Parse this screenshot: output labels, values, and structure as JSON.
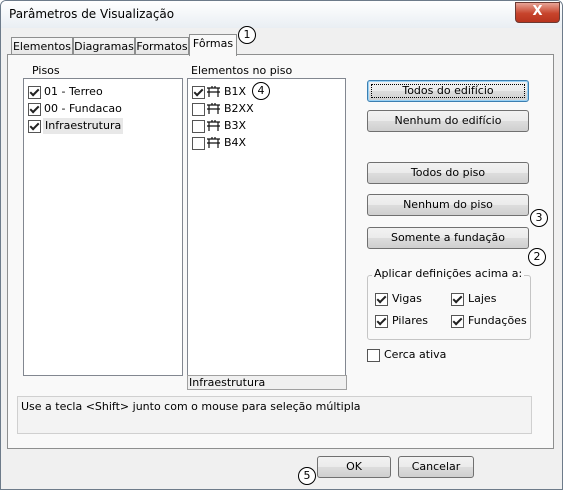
{
  "window": {
    "title": "Parâmetros de Visualização",
    "close_symbol": "X"
  },
  "tabs": [
    {
      "label": "Elementos",
      "active": false
    },
    {
      "label": "Diagramas",
      "active": false
    },
    {
      "label": "Formatos",
      "active": false
    },
    {
      "label": "Fôrmas",
      "active": true
    }
  ],
  "pisos": {
    "label": "Pisos",
    "items": [
      {
        "label": "01 - Terreo",
        "checked": true
      },
      {
        "label": "00 - Fundacao",
        "checked": true
      },
      {
        "label": "Infraestrutura",
        "checked": true,
        "selected": true
      }
    ]
  },
  "elementos": {
    "label": "Elementos no piso",
    "items": [
      {
        "label": "B1X",
        "checked": true,
        "icon": "beam-icon"
      },
      {
        "label": "B2XX",
        "checked": false,
        "icon": "beam-icon"
      },
      {
        "label": "B3X",
        "checked": false,
        "icon": "beam-icon"
      },
      {
        "label": "B4X",
        "checked": false,
        "icon": "beam-icon"
      }
    ],
    "status": "Infraestrutura"
  },
  "buttons": {
    "todos_edificio": "Todos do edifício",
    "nenhum_edificio": "Nenhum do edifício",
    "todos_piso": "Todos do piso",
    "nenhum_piso": "Nenhum do piso",
    "somente_fundacao": "Somente a fundação"
  },
  "apply_group": {
    "title": "Aplicar definições acima a:",
    "vigas": {
      "label": "Vigas",
      "checked": true
    },
    "lajes": {
      "label": "Lajes",
      "checked": true
    },
    "pilares": {
      "label": "Pilares",
      "checked": true
    },
    "fundacoes": {
      "label": "Fundações",
      "checked": true
    }
  },
  "cerca_ativa": {
    "label": "Cerca ativa",
    "checked": false
  },
  "hint": "Use a tecla <Shift> junto com o mouse para seleção múltipla",
  "footer": {
    "ok": "OK",
    "cancel": "Cancelar"
  },
  "markers": [
    "1",
    "2",
    "3",
    "4",
    "5"
  ]
}
